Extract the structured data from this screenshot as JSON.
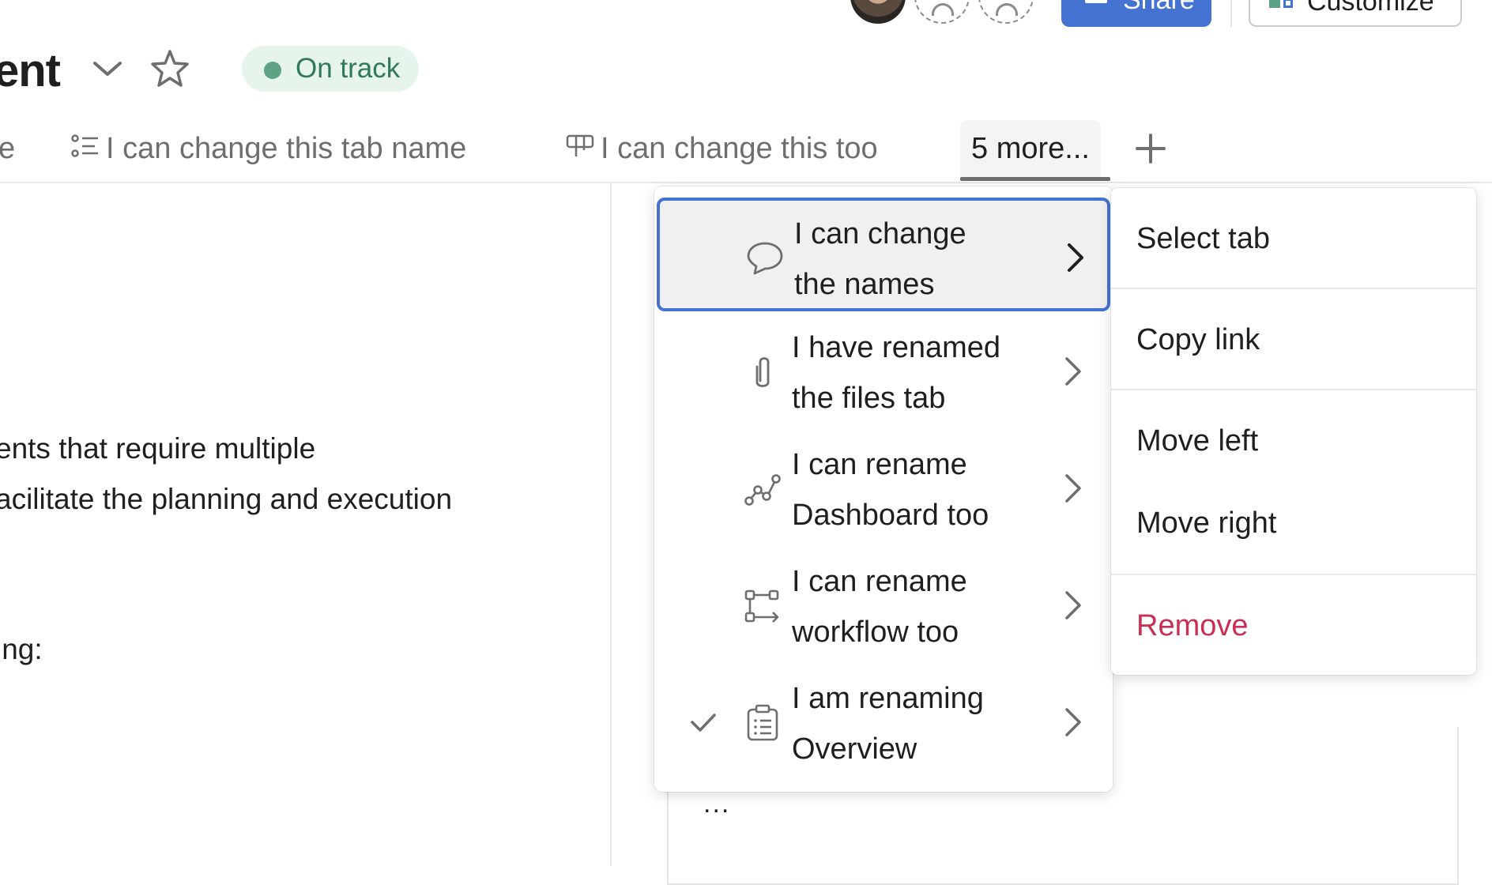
{
  "top_bar": {
    "share_label": "Share",
    "customize_label": "Customize"
  },
  "header": {
    "title": "ent",
    "status": "On track",
    "status_color": "#5da283"
  },
  "tabs": [
    {
      "label": "e",
      "icon": ""
    },
    {
      "label": "I can change this tab name",
      "icon": "list-icon"
    },
    {
      "label": "I can change this too",
      "icon": "board-icon"
    },
    {
      "label": "5 more...",
      "icon": "",
      "active": true
    }
  ],
  "body_lines": [
    "ents that require multiple",
    "acilitate the planning and execution",
    "ing:"
  ],
  "more_menu": {
    "items": [
      {
        "line1": "I can change",
        "line2": "the names",
        "icon": "message-icon",
        "highlighted": true,
        "checked": false
      },
      {
        "line1": "I have renamed",
        "line2": "the files tab",
        "icon": "paperclip-icon",
        "highlighted": false,
        "checked": false
      },
      {
        "line1": "I can rename",
        "line2": "Dashboard too",
        "icon": "dashboard-icon",
        "highlighted": false,
        "checked": false
      },
      {
        "line1": "I can rename",
        "line2": "workflow too",
        "icon": "workflow-icon",
        "highlighted": false,
        "checked": false
      },
      {
        "line1": "I am renaming",
        "line2": "Overview",
        "icon": "clipboard-icon",
        "highlighted": false,
        "checked": true
      }
    ]
  },
  "context_menu": {
    "select_tab": "Select tab",
    "copy_link": "Copy link",
    "move_left": "Move left",
    "move_right": "Move right",
    "remove": "Remove"
  },
  "panel_ellipsis": "...",
  "colors": {
    "accent": "#4573d2",
    "danger": "#c92f54",
    "status_bg": "#e6f4ec"
  }
}
